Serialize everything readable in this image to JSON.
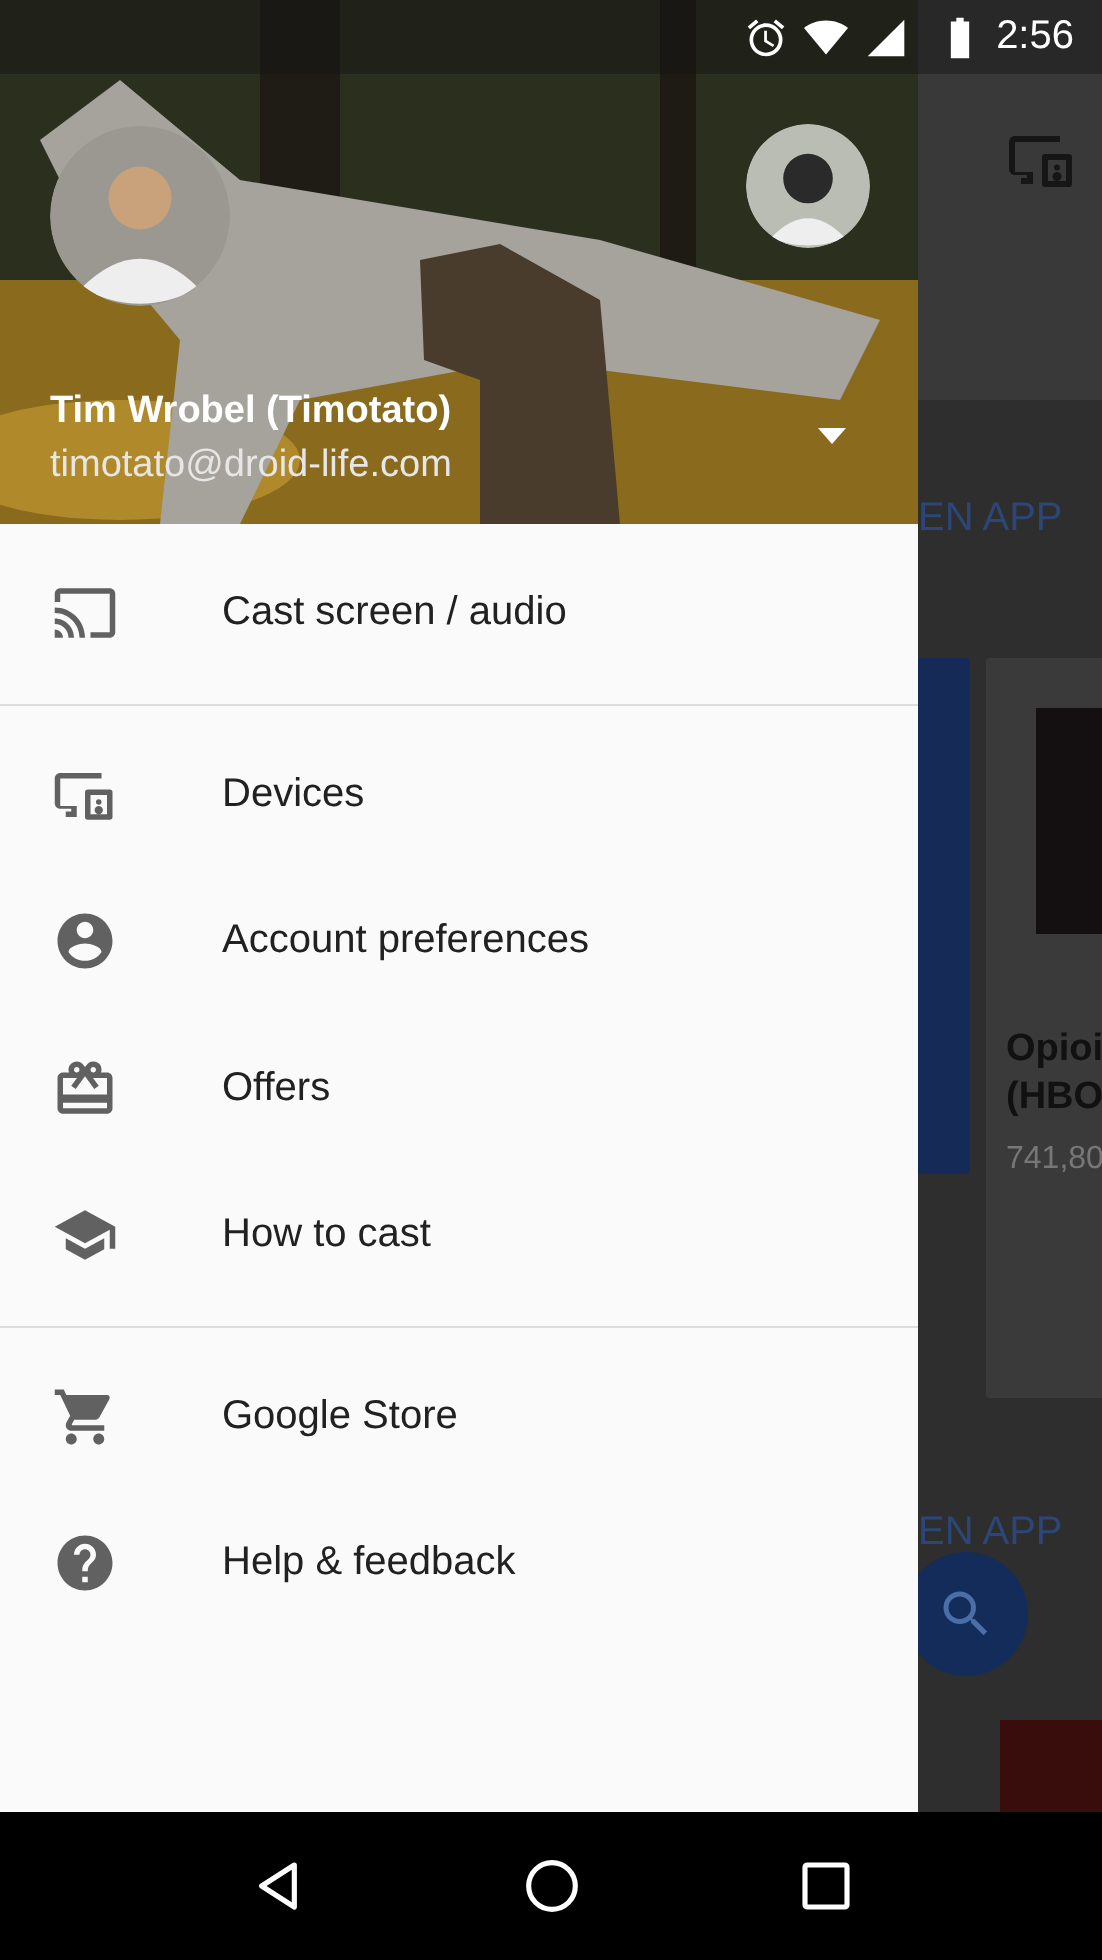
{
  "status_bar": {
    "time": "2:56"
  },
  "drawer": {
    "account": {
      "name": "Tim Wrobel (Timotato)",
      "email": "timotato@droid-life.com"
    },
    "sections": [
      [
        {
          "label": "Cast screen / audio"
        }
      ],
      [
        {
          "label": "Devices"
        },
        {
          "label": "Account preferences"
        },
        {
          "label": "Offers"
        },
        {
          "label": "How to cast"
        }
      ],
      [
        {
          "label": "Google Store"
        },
        {
          "label": "Help & feedback"
        }
      ]
    ]
  },
  "background_app": {
    "top_action": "EN APP",
    "card_title_lines": [
      "Opioi",
      "(HBO"
    ],
    "card_count": "741,80",
    "bottom_action": "EN APP"
  }
}
